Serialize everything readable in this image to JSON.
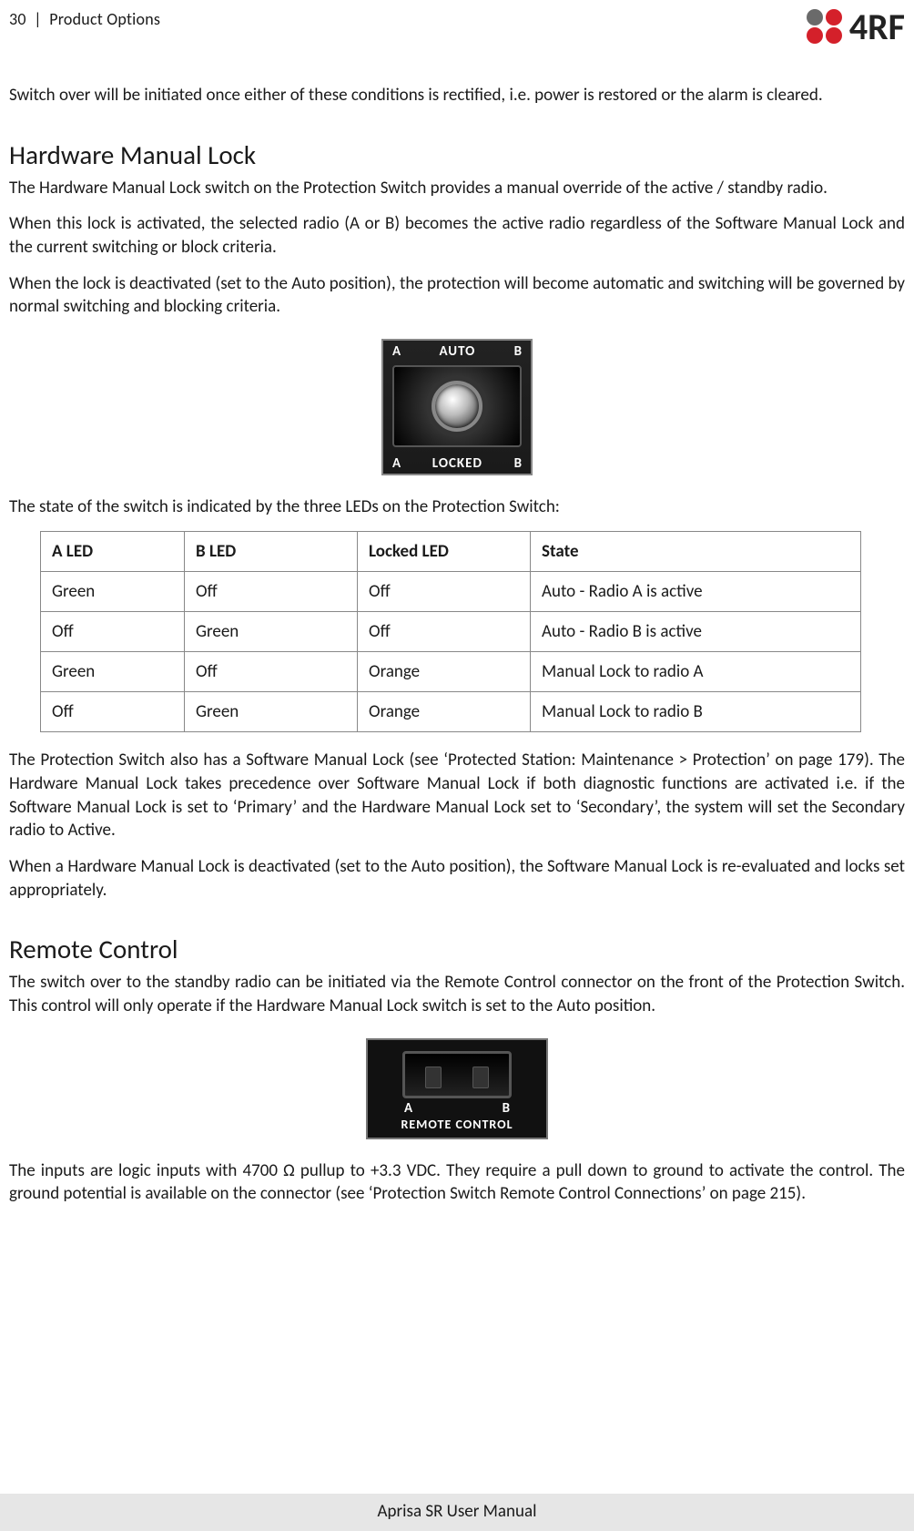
{
  "header": {
    "page_number": "30",
    "section": "Product Options",
    "brand": "4RF"
  },
  "intro": "Switch over will be initiated once either of these conditions is rectified, i.e. power is restored or the alarm is cleared.",
  "hml": {
    "title": "Hardware Manual Lock",
    "p1": "The Hardware Manual Lock switch on the Protection Switch provides a manual override of the active / standby radio.",
    "p2": "When this lock is activated, the selected radio (A or B) becomes the active radio regardless of the Software Manual Lock and the current switching or block criteria.",
    "p3": "When the lock is deactivated (set to the Auto position), the protection will become automatic and switching will be governed by normal switching and blocking criteria.",
    "switch_labels": {
      "a": "A",
      "auto": "AUTO",
      "b": "B",
      "locked": "LOCKED"
    },
    "leds_intro": "The state of the switch is indicated by the three LEDs on the Protection Switch:",
    "table": {
      "headers": [
        "A LED",
        "B LED",
        "Locked LED",
        "State"
      ],
      "rows": [
        [
          "Green",
          "Off",
          "Off",
          "Auto - Radio A is active"
        ],
        [
          "Off",
          "Green",
          "Off",
          "Auto - Radio B is active"
        ],
        [
          "Green",
          "Off",
          "Orange",
          "Manual Lock to radio A"
        ],
        [
          "Off",
          "Green",
          "Orange",
          "Manual Lock to radio B"
        ]
      ]
    },
    "p4": "The Protection Switch also has a Software Manual Lock (see ‘Protected Station: Maintenance > Protection’ on page 179). The Hardware Manual Lock takes precedence over Software Manual Lock if both diagnostic functions are activated i.e. if the Software Manual Lock is set to ‘Primary’ and the Hardware Manual Lock set to ‘Secondary’, the system will set the Secondary radio to Active.",
    "p5": "When a Hardware Manual Lock is deactivated (set to the Auto position), the Software Manual Lock is re-evaluated and locks set appropriately."
  },
  "rc": {
    "title": "Remote Control",
    "p1": "The switch over to the standby radio can be initiated via the Remote Control connector on the front of the Protection Switch. This control will only operate if the Hardware Manual Lock switch is set to the Auto position.",
    "labels": {
      "a": "A",
      "b": "B",
      "title": "REMOTE CONTROL"
    },
    "p2": "The inputs are logic inputs with 4700 Ω pullup to +3.3 VDC. They require a pull down to ground to activate the control. The ground potential is available on the connector (see ‘Protection Switch Remote Control Connections’ on page 215)."
  },
  "footer": "Aprisa SR User Manual"
}
